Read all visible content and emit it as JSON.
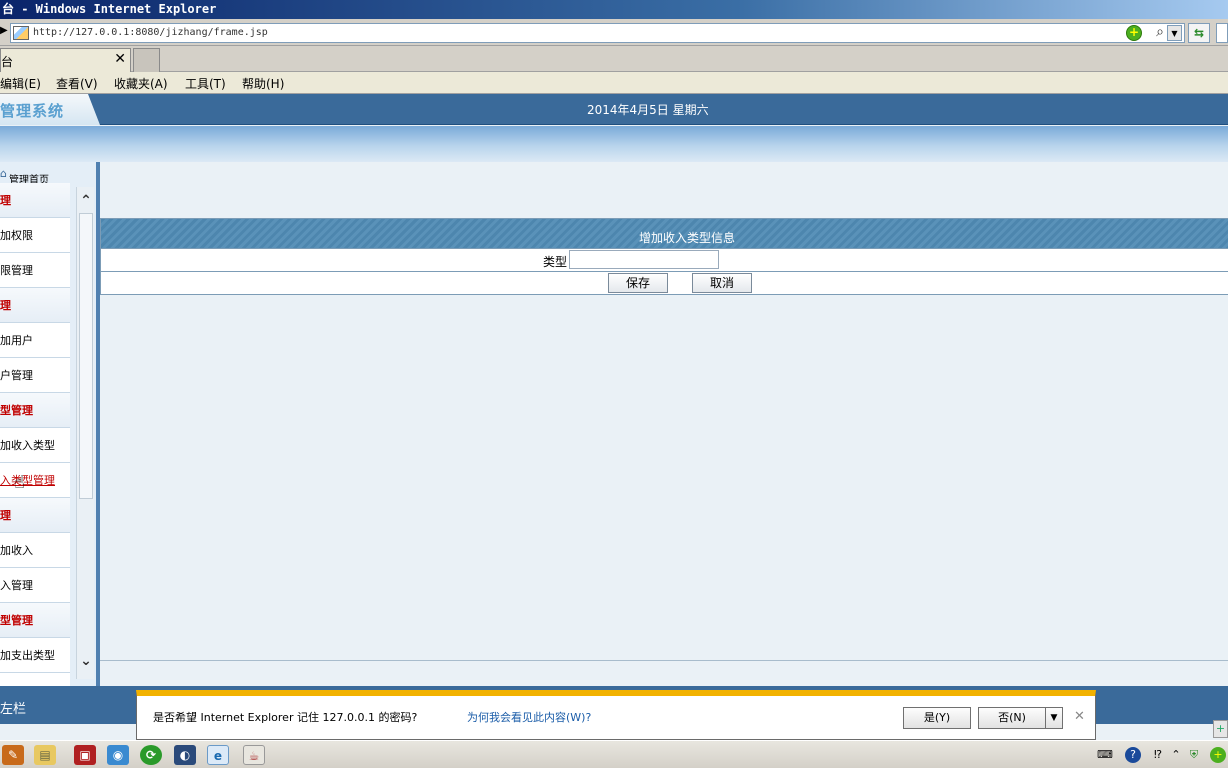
{
  "window": {
    "title": "台 - Windows Internet Explorer"
  },
  "address": {
    "url": "http://127.0.0.1:8080/jizhang/frame.jsp"
  },
  "tab": {
    "title": "台"
  },
  "menu": {
    "items": [
      "编辑(E)",
      "查看(V)",
      "收藏夹(A)",
      "工具(T)",
      "帮助(H)"
    ]
  },
  "header": {
    "logo": "管理系统",
    "date": "2014年4月5日 星期六"
  },
  "sidebar": {
    "home": "管理首页",
    "items": [
      {
        "label": "管理",
        "kind": "category"
      },
      {
        "label": "添加权限",
        "kind": "link"
      },
      {
        "label": "权限管理",
        "kind": "link"
      },
      {
        "label": "管理",
        "kind": "category"
      },
      {
        "label": "添加用户",
        "kind": "link"
      },
      {
        "label": "用户管理",
        "kind": "link"
      },
      {
        "label": "类型管理",
        "kind": "category"
      },
      {
        "label": "添加收入类型",
        "kind": "link"
      },
      {
        "label": "收入类型管理",
        "kind": "hover"
      },
      {
        "label": "管理",
        "kind": "category"
      },
      {
        "label": "添加收入",
        "kind": "link"
      },
      {
        "label": "收入管理",
        "kind": "link"
      },
      {
        "label": "类型管理",
        "kind": "category"
      },
      {
        "label": "添加支出类型",
        "kind": "link"
      }
    ]
  },
  "form": {
    "title": "增加收入类型信息",
    "type_label": "类型",
    "type_value": "",
    "save_label": "保存",
    "cancel_label": "取消"
  },
  "bottom": {
    "label": "左栏"
  },
  "notification": {
    "message": "是否希望 Internet Explorer 记住 127.0.0.1 的密码?",
    "link": "为何我会看见此内容(W)?",
    "yes_label": "是(Y)",
    "no_label": "否(N)"
  },
  "colors": {
    "header_blue": "#3a6a9a",
    "category_red": "#c00000",
    "notify_bar": "#f2b200"
  }
}
